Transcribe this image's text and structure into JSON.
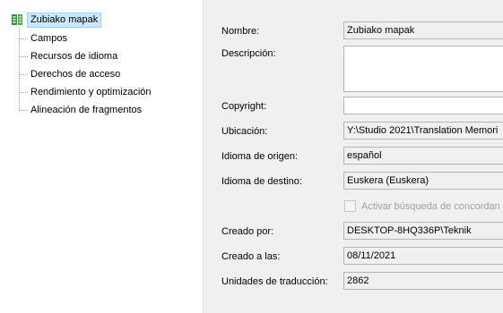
{
  "tree": {
    "root": "Zubiako mapak",
    "root_icon": "translation-memory-icon",
    "children": [
      "Campos",
      "Recursos de idioma",
      "Derechos de acceso",
      "Rendimiento y optimización",
      "Alineación de fragmentos"
    ]
  },
  "form": {
    "name_label": "Nombre:",
    "name_value": "Zubiako mapak",
    "description_label": "Descripción:",
    "description_value": "",
    "copyright_label": "Copyright:",
    "copyright_value": "",
    "location_label": "Ubicación:",
    "location_value": "Y:\\Studio 2021\\Translation Memori",
    "source_label": "Idioma de origen:",
    "source_value": "español",
    "target_label": "Idioma de destino:",
    "target_value": "Euskera (Euskera)",
    "checkbox_label": "Activar búsqueda de concordan",
    "created_by_label": "Creado por:",
    "created_by_value": "DESKTOP-8HQ336P\\Teknik",
    "created_at_label": "Creado a las:",
    "created_at_value": "08/11/2021",
    "units_label": "Unidades de traducción:",
    "units_value": "2862"
  },
  "colors": {
    "selection": "#cce8ff",
    "panel": "#f0f0f0",
    "icon_green": "#2e9b3e"
  }
}
